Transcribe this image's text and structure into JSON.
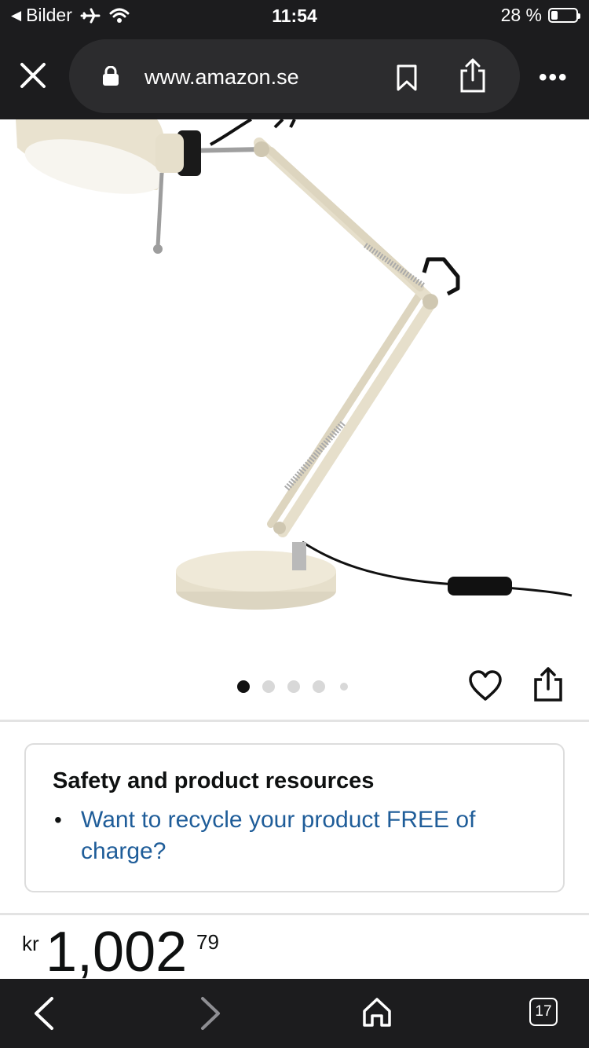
{
  "status_bar": {
    "back_app_label": "Bilder",
    "time": "11:54",
    "battery_percent": "28 %",
    "battery_level": 0.28
  },
  "browser": {
    "url": "www.amazon.se",
    "tab_count": "17"
  },
  "gallery": {
    "image_count": 5,
    "active_index": 0
  },
  "safety": {
    "title": "Safety and product resources",
    "link_text": "Want to recycle your product FREE of charge?"
  },
  "price": {
    "currency_symbol": "kr",
    "whole": "1,002",
    "fraction": "79"
  },
  "colors": {
    "chrome_bg": "#1c1c1e",
    "url_bar_bg": "#2c2c2e",
    "link": "#1f5d99",
    "lamp_body": "#e8e2cf"
  }
}
